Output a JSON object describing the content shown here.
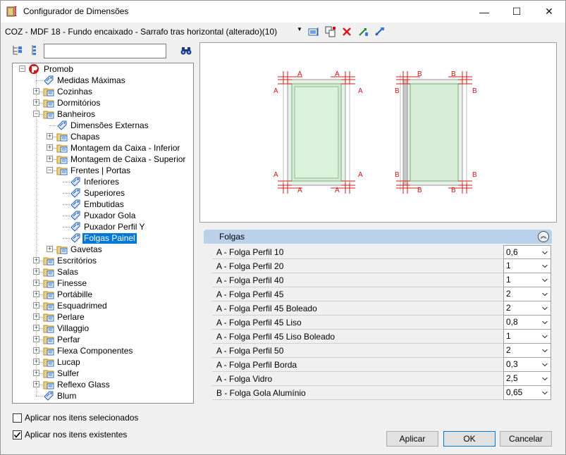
{
  "window": {
    "title": "Configurador de Dimensões",
    "minimize": "—",
    "maximize": "☐",
    "close": "✕"
  },
  "selector": {
    "value": "COZ - MDF 18 - Fundo encaixado - Sarrafo tras horizontal (alterado)(10)"
  },
  "search": {
    "value": ""
  },
  "tree": {
    "root": "Promob",
    "items": [
      {
        "label": "Medidas Máximas"
      },
      {
        "label": "Cozinhas"
      },
      {
        "label": "Dormitórios"
      },
      {
        "label": "Banheiros"
      },
      {
        "label": "Dimensões Externas"
      },
      {
        "label": "Chapas"
      },
      {
        "label": "Montagem da Caixa - Inferior"
      },
      {
        "label": "Montagem de Caixa - Superior"
      },
      {
        "label": "Frentes | Portas"
      },
      {
        "label": "Inferiores"
      },
      {
        "label": "Superiores"
      },
      {
        "label": "Embutidas"
      },
      {
        "label": "Puxador Gola"
      },
      {
        "label": "Puxador Perfil Y"
      },
      {
        "label": "Folgas Painel"
      },
      {
        "label": "Gavetas"
      },
      {
        "label": "Escritórios"
      },
      {
        "label": "Salas"
      },
      {
        "label": "Finesse"
      },
      {
        "label": "Portábille"
      },
      {
        "label": "Esquadrimed"
      },
      {
        "label": "Perlare"
      },
      {
        "label": "Villaggio"
      },
      {
        "label": "Perfar"
      },
      {
        "label": "Flexa Componentes"
      },
      {
        "label": "Lucap"
      },
      {
        "label": "Sulfer"
      },
      {
        "label": "Reflexo Glass"
      },
      {
        "label": "Blum"
      }
    ]
  },
  "preview": {
    "label_a": "A",
    "label_b": "B"
  },
  "properties": {
    "section": "Folgas",
    "rows": [
      {
        "name": "A - Folga Perfil 10",
        "value": "0,6"
      },
      {
        "name": "A - Folga Perfil 20",
        "value": "1"
      },
      {
        "name": "A - Folga Perfil 40",
        "value": "1"
      },
      {
        "name": "A - Folga Perfil 45",
        "value": "2"
      },
      {
        "name": "A - Folga Perfil 45 Boleado",
        "value": "2"
      },
      {
        "name": "A - Folga Perfil 45 Liso",
        "value": "0,8"
      },
      {
        "name": "A - Folga Perfil 45 Liso Boleado",
        "value": "1"
      },
      {
        "name": "A - Folga Perfil 50",
        "value": "2"
      },
      {
        "name": "A - Folga Perfil Borda",
        "value": "0,3"
      },
      {
        "name": "A - Folga Vidro",
        "value": "2,5"
      },
      {
        "name": "B - Folga Gola Alumínio",
        "value": "0,65"
      }
    ]
  },
  "options": {
    "apply_selected": "Aplicar nos itens selecionados",
    "apply_selected_checked": false,
    "apply_existing": "Aplicar nos itens existentes",
    "apply_existing_checked": true
  },
  "buttons": {
    "apply": "Aplicar",
    "ok": "OK",
    "cancel": "Cancelar"
  }
}
